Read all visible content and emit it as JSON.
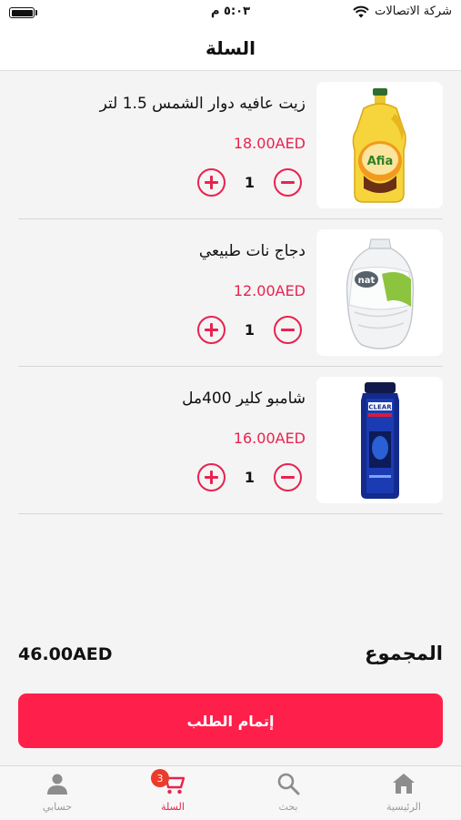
{
  "status_bar": {
    "carrier": "شركة الاتصالات",
    "time": "٥:٠٣ م"
  },
  "header": {
    "title": "السلة"
  },
  "cart": {
    "items": [
      {
        "name": "زيت عافيه دوار الشمس 1.5 لتر",
        "price": "18.00AED",
        "quantity": "1",
        "image_label": "Afia"
      },
      {
        "name": "دجاج نات طبيعي",
        "price": "12.00AED",
        "quantity": "1",
        "image_label": "nat"
      },
      {
        "name": "شامبو كلير 400مل",
        "price": "16.00AED",
        "quantity": "1",
        "image_label": "CLEAR"
      }
    ]
  },
  "summary": {
    "total_label": "المجموع",
    "total_value": "46.00AED"
  },
  "checkout": {
    "label": "إتمام الطلب"
  },
  "tab_bar": {
    "tabs": [
      {
        "label": "الرئيسية",
        "icon": "home-icon"
      },
      {
        "label": "بحث",
        "icon": "search-icon"
      },
      {
        "label": "السلة",
        "icon": "cart-icon",
        "badge": "3",
        "active": true
      },
      {
        "label": "حسابي",
        "icon": "user-icon"
      }
    ]
  },
  "colors": {
    "accent": "#e8234f",
    "button": "#ff1f4b",
    "badge": "#ea3b2b"
  }
}
